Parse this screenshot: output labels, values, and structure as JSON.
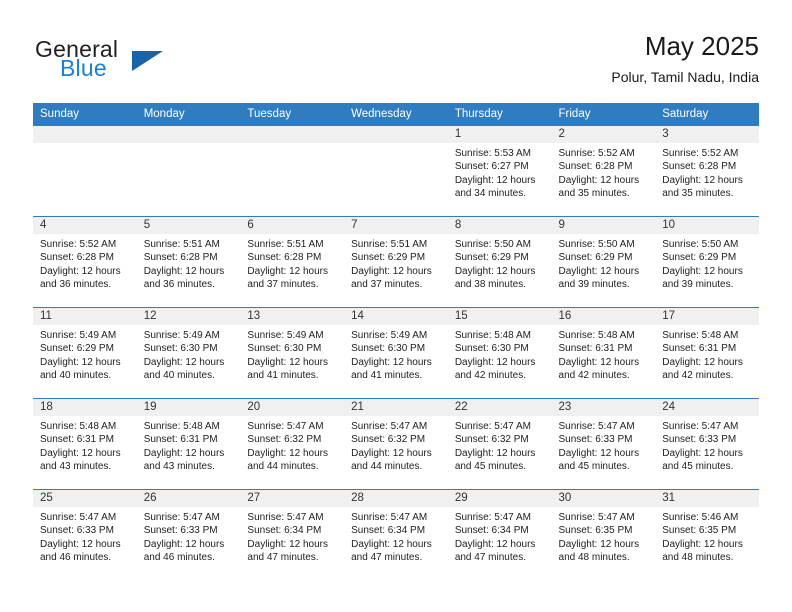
{
  "brand": {
    "name_top": "General",
    "name_bottom": "Blue",
    "accent_color": "#1d7fd1",
    "triangle_color": "#1565a8"
  },
  "header": {
    "title": "May 2025",
    "subtitle": "Polur, Tamil Nadu, India",
    "header_bg": "#2f7dc0",
    "header_text_color": "#ffffff"
  },
  "weekday_headers": [
    "Sunday",
    "Monday",
    "Tuesday",
    "Wednesday",
    "Thursday",
    "Friday",
    "Saturday"
  ],
  "labels": {
    "sunrise_prefix": "Sunrise:",
    "sunset_prefix": "Sunset:",
    "daylight_prefix": "Daylight:"
  },
  "weeks": [
    [
      {
        "day": "",
        "empty": true
      },
      {
        "day": "",
        "empty": true
      },
      {
        "day": "",
        "empty": true
      },
      {
        "day": "",
        "empty": true
      },
      {
        "day": "1",
        "sunrise": "Sunrise: 5:53 AM",
        "sunset": "Sunset: 6:27 PM",
        "daylight_line1": "Daylight: 12 hours",
        "daylight_line2": "and 34 minutes."
      },
      {
        "day": "2",
        "sunrise": "Sunrise: 5:52 AM",
        "sunset": "Sunset: 6:28 PM",
        "daylight_line1": "Daylight: 12 hours",
        "daylight_line2": "and 35 minutes."
      },
      {
        "day": "3",
        "sunrise": "Sunrise: 5:52 AM",
        "sunset": "Sunset: 6:28 PM",
        "daylight_line1": "Daylight: 12 hours",
        "daylight_line2": "and 35 minutes."
      }
    ],
    [
      {
        "day": "4",
        "sunrise": "Sunrise: 5:52 AM",
        "sunset": "Sunset: 6:28 PM",
        "daylight_line1": "Daylight: 12 hours",
        "daylight_line2": "and 36 minutes."
      },
      {
        "day": "5",
        "sunrise": "Sunrise: 5:51 AM",
        "sunset": "Sunset: 6:28 PM",
        "daylight_line1": "Daylight: 12 hours",
        "daylight_line2": "and 36 minutes."
      },
      {
        "day": "6",
        "sunrise": "Sunrise: 5:51 AM",
        "sunset": "Sunset: 6:28 PM",
        "daylight_line1": "Daylight: 12 hours",
        "daylight_line2": "and 37 minutes."
      },
      {
        "day": "7",
        "sunrise": "Sunrise: 5:51 AM",
        "sunset": "Sunset: 6:29 PM",
        "daylight_line1": "Daylight: 12 hours",
        "daylight_line2": "and 37 minutes."
      },
      {
        "day": "8",
        "sunrise": "Sunrise: 5:50 AM",
        "sunset": "Sunset: 6:29 PM",
        "daylight_line1": "Daylight: 12 hours",
        "daylight_line2": "and 38 minutes."
      },
      {
        "day": "9",
        "sunrise": "Sunrise: 5:50 AM",
        "sunset": "Sunset: 6:29 PM",
        "daylight_line1": "Daylight: 12 hours",
        "daylight_line2": "and 39 minutes."
      },
      {
        "day": "10",
        "sunrise": "Sunrise: 5:50 AM",
        "sunset": "Sunset: 6:29 PM",
        "daylight_line1": "Daylight: 12 hours",
        "daylight_line2": "and 39 minutes."
      }
    ],
    [
      {
        "day": "11",
        "sunrise": "Sunrise: 5:49 AM",
        "sunset": "Sunset: 6:29 PM",
        "daylight_line1": "Daylight: 12 hours",
        "daylight_line2": "and 40 minutes."
      },
      {
        "day": "12",
        "sunrise": "Sunrise: 5:49 AM",
        "sunset": "Sunset: 6:30 PM",
        "daylight_line1": "Daylight: 12 hours",
        "daylight_line2": "and 40 minutes."
      },
      {
        "day": "13",
        "sunrise": "Sunrise: 5:49 AM",
        "sunset": "Sunset: 6:30 PM",
        "daylight_line1": "Daylight: 12 hours",
        "daylight_line2": "and 41 minutes."
      },
      {
        "day": "14",
        "sunrise": "Sunrise: 5:49 AM",
        "sunset": "Sunset: 6:30 PM",
        "daylight_line1": "Daylight: 12 hours",
        "daylight_line2": "and 41 minutes."
      },
      {
        "day": "15",
        "sunrise": "Sunrise: 5:48 AM",
        "sunset": "Sunset: 6:30 PM",
        "daylight_line1": "Daylight: 12 hours",
        "daylight_line2": "and 42 minutes."
      },
      {
        "day": "16",
        "sunrise": "Sunrise: 5:48 AM",
        "sunset": "Sunset: 6:31 PM",
        "daylight_line1": "Daylight: 12 hours",
        "daylight_line2": "and 42 minutes."
      },
      {
        "day": "17",
        "sunrise": "Sunrise: 5:48 AM",
        "sunset": "Sunset: 6:31 PM",
        "daylight_line1": "Daylight: 12 hours",
        "daylight_line2": "and 42 minutes."
      }
    ],
    [
      {
        "day": "18",
        "sunrise": "Sunrise: 5:48 AM",
        "sunset": "Sunset: 6:31 PM",
        "daylight_line1": "Daylight: 12 hours",
        "daylight_line2": "and 43 minutes."
      },
      {
        "day": "19",
        "sunrise": "Sunrise: 5:48 AM",
        "sunset": "Sunset: 6:31 PM",
        "daylight_line1": "Daylight: 12 hours",
        "daylight_line2": "and 43 minutes."
      },
      {
        "day": "20",
        "sunrise": "Sunrise: 5:47 AM",
        "sunset": "Sunset: 6:32 PM",
        "daylight_line1": "Daylight: 12 hours",
        "daylight_line2": "and 44 minutes."
      },
      {
        "day": "21",
        "sunrise": "Sunrise: 5:47 AM",
        "sunset": "Sunset: 6:32 PM",
        "daylight_line1": "Daylight: 12 hours",
        "daylight_line2": "and 44 minutes."
      },
      {
        "day": "22",
        "sunrise": "Sunrise: 5:47 AM",
        "sunset": "Sunset: 6:32 PM",
        "daylight_line1": "Daylight: 12 hours",
        "daylight_line2": "and 45 minutes."
      },
      {
        "day": "23",
        "sunrise": "Sunrise: 5:47 AM",
        "sunset": "Sunset: 6:33 PM",
        "daylight_line1": "Daylight: 12 hours",
        "daylight_line2": "and 45 minutes."
      },
      {
        "day": "24",
        "sunrise": "Sunrise: 5:47 AM",
        "sunset": "Sunset: 6:33 PM",
        "daylight_line1": "Daylight: 12 hours",
        "daylight_line2": "and 45 minutes."
      }
    ],
    [
      {
        "day": "25",
        "sunrise": "Sunrise: 5:47 AM",
        "sunset": "Sunset: 6:33 PM",
        "daylight_line1": "Daylight: 12 hours",
        "daylight_line2": "and 46 minutes."
      },
      {
        "day": "26",
        "sunrise": "Sunrise: 5:47 AM",
        "sunset": "Sunset: 6:33 PM",
        "daylight_line1": "Daylight: 12 hours",
        "daylight_line2": "and 46 minutes."
      },
      {
        "day": "27",
        "sunrise": "Sunrise: 5:47 AM",
        "sunset": "Sunset: 6:34 PM",
        "daylight_line1": "Daylight: 12 hours",
        "daylight_line2": "and 47 minutes."
      },
      {
        "day": "28",
        "sunrise": "Sunrise: 5:47 AM",
        "sunset": "Sunset: 6:34 PM",
        "daylight_line1": "Daylight: 12 hours",
        "daylight_line2": "and 47 minutes."
      },
      {
        "day": "29",
        "sunrise": "Sunrise: 5:47 AM",
        "sunset": "Sunset: 6:34 PM",
        "daylight_line1": "Daylight: 12 hours",
        "daylight_line2": "and 47 minutes."
      },
      {
        "day": "30",
        "sunrise": "Sunrise: 5:47 AM",
        "sunset": "Sunset: 6:35 PM",
        "daylight_line1": "Daylight: 12 hours",
        "daylight_line2": "and 48 minutes."
      },
      {
        "day": "31",
        "sunrise": "Sunrise: 5:46 AM",
        "sunset": "Sunset: 6:35 PM",
        "daylight_line1": "Daylight: 12 hours",
        "daylight_line2": "and 48 minutes."
      }
    ]
  ]
}
